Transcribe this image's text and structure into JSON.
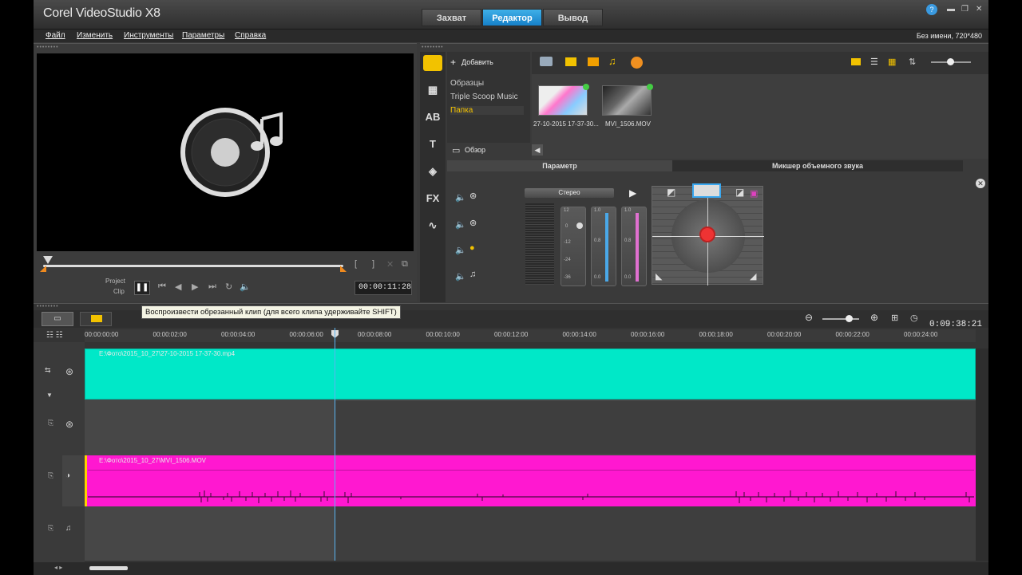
{
  "app": {
    "title": "Corel VideoStudio X8"
  },
  "mode_tabs": [
    {
      "label": "Захват",
      "active": false
    },
    {
      "label": "Редактор",
      "active": true
    },
    {
      "label": "Вывод",
      "active": false
    }
  ],
  "menu": [
    "Файл",
    "Изменить",
    "Инструменты",
    "Параметры",
    "Справка"
  ],
  "project_info": "Без имени, 720*480",
  "player": {
    "mode_project": "Project",
    "mode_clip": "Clip",
    "timecode": "00:00:11:28",
    "tooltip": "Воспроизвести обрезанный клип (для всего клипа удерживайте SHIFT)"
  },
  "library": {
    "add_label": "Добавить",
    "folders": [
      {
        "label": "Образцы",
        "selected": false
      },
      {
        "label": "Triple Scoop Music",
        "selected": false
      },
      {
        "label": "Папка",
        "selected": true
      }
    ],
    "browse_label": "Обзор",
    "media": [
      {
        "label": "27-10-2015 17-37-30..."
      },
      {
        "label": "MVI_1506.MOV"
      }
    ],
    "option_tabs": [
      {
        "label": "Параметр",
        "active": false
      },
      {
        "label": "Микшер объемного звука",
        "active": true
      }
    ],
    "mixer": {
      "stereo_label": "Стерео",
      "meter_scale": [
        "12",
        "0",
        "-12",
        "-24",
        "-36"
      ],
      "slider_scale": [
        "1.0",
        "0.8",
        "0.0"
      ]
    }
  },
  "timeline": {
    "duration": "0:09:38:21",
    "ticks": [
      "00:00:00:00",
      "00:00:02:00",
      "00:00:04:00",
      "00:00:06:00",
      "00:00:08:00",
      "00:00:10:00",
      "00:00:12:00",
      "00:00:14:00",
      "00:00:16:00",
      "00:00:18:00",
      "00:00:20:00",
      "00:00:22:00",
      "00:00:24:00"
    ],
    "video_clip": "E:\\Фото\\2015_10_27\\27-10-2015 17-37-30.mp4",
    "audio_clip": "E:\\Фото\\2015_10_27\\MVI_1506.MOV"
  },
  "colors": {
    "video_clip": "#00e8c8",
    "audio_clip": "#ff18d0",
    "accent": "#1e90d8"
  }
}
